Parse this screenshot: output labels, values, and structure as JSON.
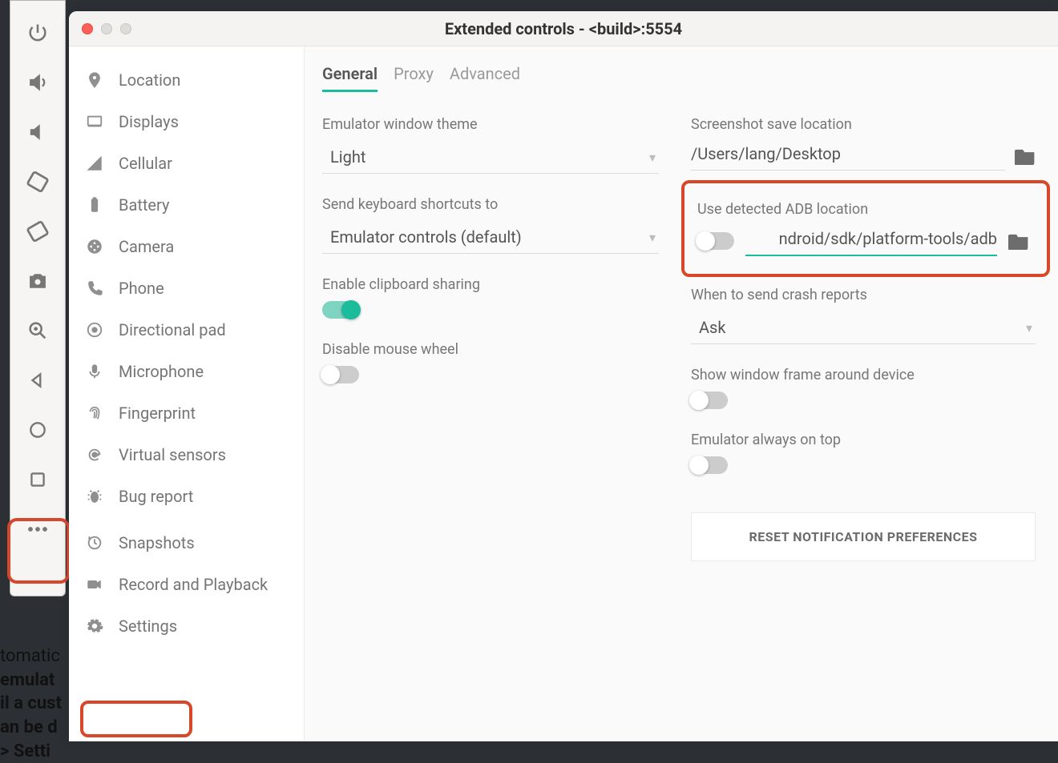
{
  "window": {
    "title": "Extended controls - <build>:5554"
  },
  "sidebar": {
    "items": [
      {
        "id": "location",
        "label": "Location"
      },
      {
        "id": "displays",
        "label": "Displays"
      },
      {
        "id": "cellular",
        "label": "Cellular"
      },
      {
        "id": "battery",
        "label": "Battery"
      },
      {
        "id": "camera",
        "label": "Camera"
      },
      {
        "id": "phone",
        "label": "Phone"
      },
      {
        "id": "directional-pad",
        "label": "Directional pad"
      },
      {
        "id": "microphone",
        "label": "Microphone"
      },
      {
        "id": "fingerprint",
        "label": "Fingerprint"
      },
      {
        "id": "virtual-sensors",
        "label": "Virtual sensors"
      },
      {
        "id": "bug-report",
        "label": "Bug report"
      },
      {
        "id": "snapshots",
        "label": "Snapshots"
      },
      {
        "id": "record-playback",
        "label": "Record and Playback"
      },
      {
        "id": "settings",
        "label": "Settings"
      }
    ]
  },
  "tabs": [
    {
      "id": "general",
      "label": "General",
      "active": true
    },
    {
      "id": "proxy",
      "label": "Proxy",
      "active": false
    },
    {
      "id": "advanced",
      "label": "Advanced",
      "active": false
    }
  ],
  "settings": {
    "theme_label": "Emulator window theme",
    "theme_value": "Light",
    "shortcuts_label": "Send keyboard shortcuts to",
    "shortcuts_value": "Emulator controls (default)",
    "clipboard_label": "Enable clipboard sharing",
    "clipboard_on": true,
    "mousewheel_label": "Disable mouse wheel",
    "mousewheel_on": false,
    "screenshot_label": "Screenshot save location",
    "screenshot_path": "/Users/lang/Desktop",
    "adb_label": "Use detected ADB location",
    "adb_on": false,
    "adb_path": "ndroid/sdk/platform-tools/adb",
    "crash_label": "When to send crash reports",
    "crash_value": "Ask",
    "frame_label": "Show window frame around device",
    "frame_on": false,
    "ontop_label": "Emulator always on top",
    "ontop_on": false,
    "reset_label": "RESET NOTIFICATION PREFERENCES"
  },
  "background_text": {
    "l1": "tomatic",
    "l2": " emulat",
    "l3": "il a cust",
    "l4": "an be d",
    "l5": " > Setti"
  },
  "colors": {
    "accent": "#1abc9c",
    "highlight": "#d7482b"
  }
}
